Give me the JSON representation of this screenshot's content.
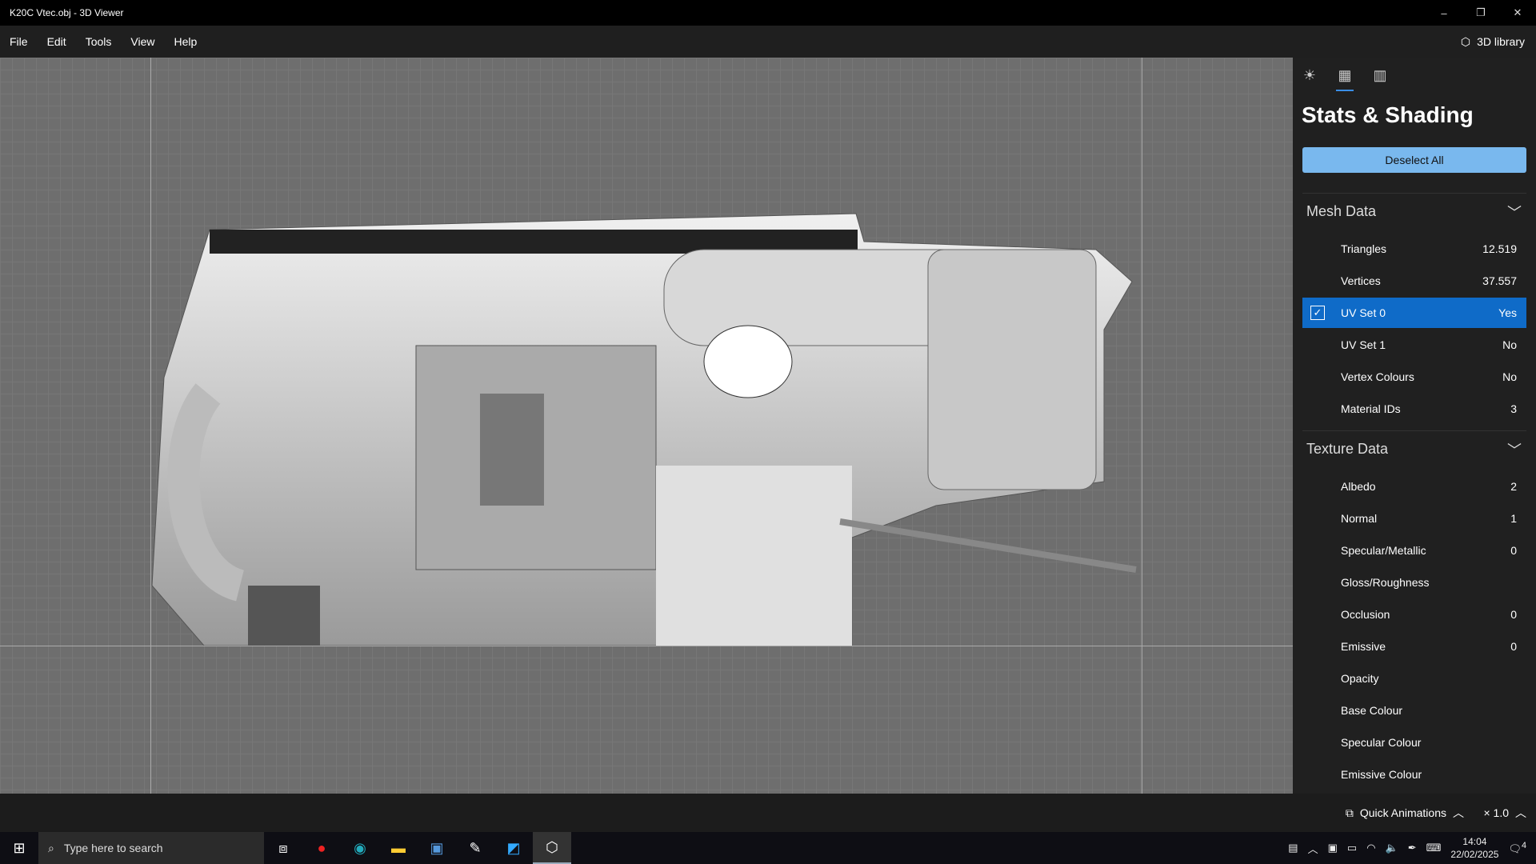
{
  "window": {
    "title": "K20C Vtec.obj - 3D Viewer",
    "minimize": "–",
    "restore": "❐",
    "close": "✕"
  },
  "menu": [
    "File",
    "Edit",
    "Tools",
    "View",
    "Help"
  ],
  "library_button": "3D library",
  "panel": {
    "tabs": [
      "lighting",
      "stats",
      "grid"
    ],
    "title": "Stats & Shading",
    "deselect": "Deselect All",
    "mesh": {
      "header": "Mesh Data",
      "rows": [
        {
          "label": "Triangles",
          "value": "12.519"
        },
        {
          "label": "Vertices",
          "value": "37.557"
        },
        {
          "label": "UV Set 0",
          "value": "Yes",
          "checked": true
        },
        {
          "label": "UV Set 1",
          "value": "No"
        },
        {
          "label": "Vertex Colours",
          "value": "No"
        },
        {
          "label": "Material IDs",
          "value": "3"
        }
      ]
    },
    "texture": {
      "header": "Texture Data",
      "rows": [
        {
          "label": "Albedo",
          "value": "2"
        },
        {
          "label": "Normal",
          "value": "1"
        },
        {
          "label": "Specular/Metallic",
          "value": "0"
        },
        {
          "label": "Gloss/Roughness",
          "value": ""
        },
        {
          "label": "Occlusion",
          "value": "0"
        },
        {
          "label": "Emissive",
          "value": "0"
        },
        {
          "label": "Opacity",
          "value": ""
        },
        {
          "label": "Base Colour",
          "value": ""
        },
        {
          "label": "Specular Colour",
          "value": ""
        },
        {
          "label": "Emissive Colour",
          "value": ""
        }
      ]
    }
  },
  "bottom": {
    "quick_animations": "Quick Animations",
    "speed": "× 1.0"
  },
  "taskbar": {
    "search_placeholder": "Type here to search",
    "time": "14:04",
    "date": "22/02/2025",
    "notifications": "4"
  }
}
